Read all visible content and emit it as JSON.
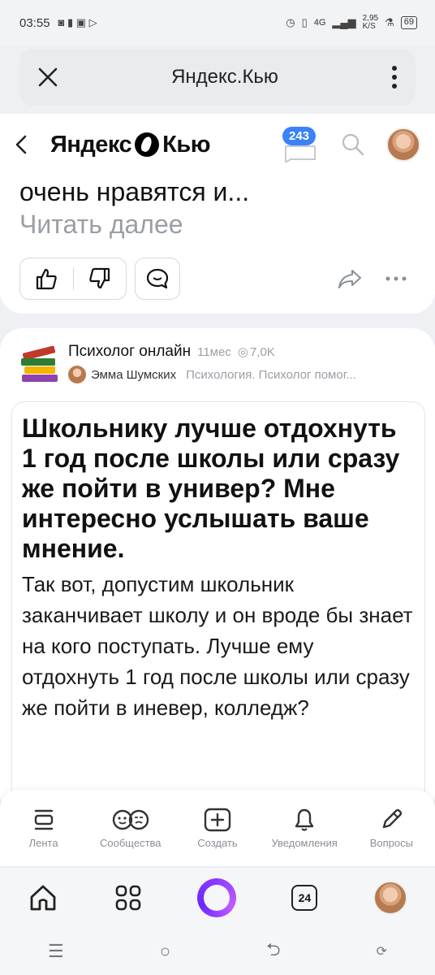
{
  "status": {
    "time": "03:55",
    "net_speed_value": "2,95",
    "net_speed_unit": "K/S",
    "battery": "69",
    "signal": "4G"
  },
  "url_bar": {
    "title": "Яндекс.Кью"
  },
  "header": {
    "logo_left": "Яндекс",
    "logo_right": "Кью",
    "badge_count": "243"
  },
  "card1": {
    "excerpt": "очень нравятся и...",
    "read_more": "Читать далее"
  },
  "post": {
    "channel": "Психолог онлайн",
    "age": "11мес",
    "views": "7,0K",
    "author": "Эмма Шумских",
    "topics": "Психология. Психолог помог...",
    "title": "Школьнику лучше отдохнуть 1 год после школы или сразу же пойти в универ? Мне интересно услышать ваше мнение.",
    "body": "Так вот, допустим школьник заканчивает школу и он вроде бы знает на кого поступать. Лучше ему отдохнуть 1 год после школы или сразу же пойти в иневер, колледж?"
  },
  "bottom_tabs": [
    {
      "label": "Лента",
      "icon": "feed-icon"
    },
    {
      "label": "Сообщества",
      "icon": "communities-icon"
    },
    {
      "label": "Создать",
      "icon": "create-icon"
    },
    {
      "label": "Уведомления",
      "icon": "bell-icon"
    },
    {
      "label": "Вопросы",
      "icon": "pencil-icon"
    }
  ],
  "browser": {
    "tabs_count": "24"
  },
  "colors": {
    "accent": "#3b82f6",
    "alice": "#8a3bff",
    "muted": "#9a9ea5"
  }
}
